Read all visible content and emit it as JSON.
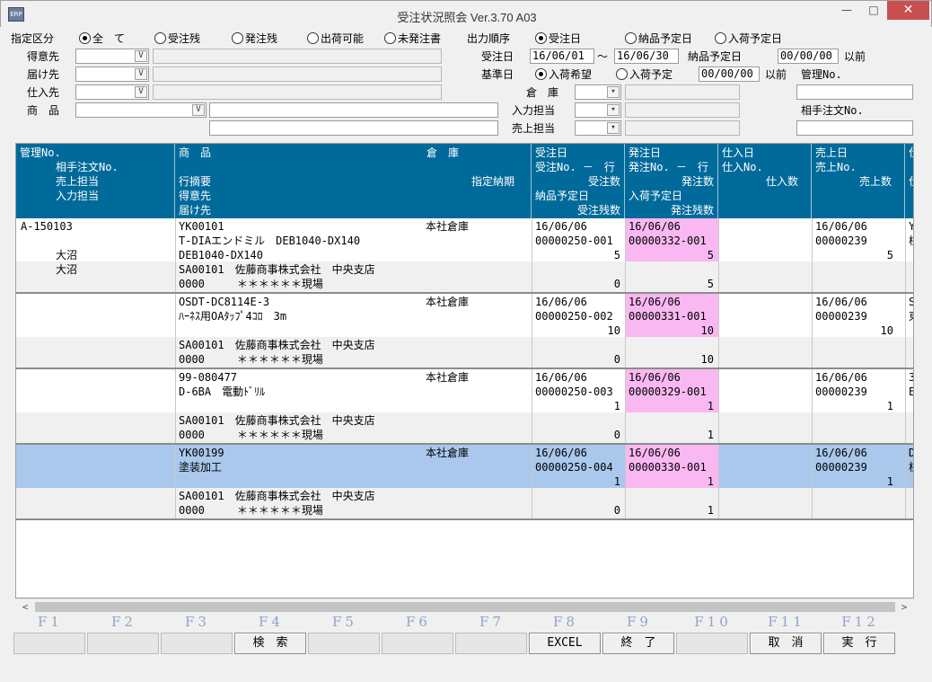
{
  "window": {
    "title": "受注状況照会 Ver.3.70 A03",
    "min_label": "—",
    "max_label": "□",
    "close_label": "✕",
    "icon_text": "ERP"
  },
  "filters": {
    "spec_label": "指定区分",
    "spec_options": [
      {
        "label": "全　て",
        "selected": true
      },
      {
        "label": "受注残",
        "selected": false
      },
      {
        "label": "発注残",
        "selected": false
      },
      {
        "label": "出荷可能",
        "selected": false
      },
      {
        "label": "未発注書",
        "selected": false
      }
    ],
    "order_label": "出力順序",
    "order_options": [
      {
        "label": "受注日",
        "selected": true
      },
      {
        "label": "納品予定日",
        "selected": false
      },
      {
        "label": "入荷予定日",
        "selected": false
      }
    ],
    "customer_label": "得意先",
    "deliver_label": "届け先",
    "supplier_label": "仕入先",
    "product_label": "商　品",
    "order_date_label": "受注日",
    "order_date_from": "16/06/01",
    "tilde": "～",
    "order_date_to": "16/06/30",
    "delivery_plan_label": "納品予定日",
    "delivery_plan_value": "00/00/00",
    "before_label": "以前",
    "base_date_label": "基準日",
    "base_options": [
      {
        "label": "入荷希望",
        "selected": true
      },
      {
        "label": "入荷予定",
        "selected": false
      }
    ],
    "base_date_value": "00/00/00",
    "mgmt_no_label": "管理No.",
    "warehouse_label": "倉　庫",
    "input_person_label": "入力担当",
    "sales_person_label": "売上担当",
    "partner_order_label": "相手注文No.",
    "combo_mark": "V",
    "dropdown_mark": "▾"
  },
  "grid": {
    "headers": {
      "col1": [
        "管理No.",
        "　　手注文No.",
        "　　売上担当",
        "　　入力担当"
      ],
      "col1_line2": "相手注文No.",
      "col2_left": [
        "商　品",
        "",
        "行摘要",
        "得意先",
        "届け先"
      ],
      "col2_warehouse": "倉　庫",
      "col2_delivery": "指定納期",
      "col3": [
        "受注日",
        "受注No. －　行",
        "受注数",
        "納品予定日",
        "受注残数"
      ],
      "col4": [
        "発注日",
        "発注No. －　行",
        "発注数",
        "入荷予定日",
        "発注残数"
      ],
      "col5": [
        "仕入日",
        "仕入No.",
        "仕入数"
      ],
      "col6": [
        "売上日",
        "売上No.",
        "売上数"
      ],
      "col7": [
        "仕",
        "",
        "仕"
      ]
    },
    "rows": [
      {
        "mgmt_no": "A-150103",
        "sales_person": "大沼",
        "input_person": "大沼",
        "product_code": "YK00101",
        "product_name": "T-DIAエンドミル　DEB1040-DX140",
        "line_memo": "DEB1040-DX140",
        "warehouse": "本社倉庫",
        "customer": "SA00101　佐藤商事株式会社　中央支店",
        "deliver": "0000　　　＊＊＊＊＊＊現場",
        "order_date": "16/06/06",
        "order_no": "00000250-001",
        "order_qty": "5",
        "order_remain": "0",
        "po_date": "16/06/06",
        "po_no": "00000332-001",
        "po_qty": "5",
        "po_remain": "5",
        "sale_date": "16/06/06",
        "sale_no": "00000239",
        "sale_qty": "5",
        "col7_a": "Y",
        "col7_b": "棟"
      },
      {
        "mgmt_no": "",
        "sales_person": "",
        "input_person": "",
        "product_code": "OSDT-DC8114E-3",
        "product_name": "ﾊｰﾈｽ用OAﾀｯﾌﾟ4ｺﾛ　3m",
        "line_memo": "",
        "warehouse": "本社倉庫",
        "customer": "SA00101　佐藤商事株式会社　中央支店",
        "deliver": "0000　　　＊＊＊＊＊＊現場",
        "order_date": "16/06/06",
        "order_no": "00000250-002",
        "order_qty": "10",
        "order_remain": "0",
        "po_date": "16/06/06",
        "po_no": "00000331-001",
        "po_qty": "10",
        "po_remain": "10",
        "sale_date": "16/06/06",
        "sale_no": "00000239",
        "sale_qty": "10",
        "col7_a": "S",
        "col7_b": "東"
      },
      {
        "mgmt_no": "",
        "sales_person": "",
        "input_person": "",
        "product_code": "99-080477",
        "product_name": "D-6BA　電動ﾄﾞﾘﾙ",
        "line_memo": "",
        "warehouse": "本社倉庫",
        "customer": "SA00101　佐藤商事株式会社　中央支店",
        "deliver": "0000　　　＊＊＊＊＊＊現場",
        "order_date": "16/06/06",
        "order_no": "00000250-003",
        "order_qty": "1",
        "order_remain": "0",
        "po_date": "16/06/06",
        "po_no": "00000329-001",
        "po_qty": "1",
        "po_remain": "1",
        "sale_date": "16/06/06",
        "sale_no": "00000239",
        "sale_qty": "1",
        "col7_a": "3",
        "col7_b": "E"
      },
      {
        "mgmt_no": "",
        "sales_person": "",
        "input_person": "",
        "product_code": "YK00199",
        "product_name": "塗装加工",
        "line_memo": "",
        "warehouse": "本社倉庫",
        "customer": "SA00101　佐藤商事株式会社　中央支店",
        "deliver": "0000　　　＊＊＊＊＊＊現場",
        "order_date": "16/06/06",
        "order_no": "00000250-004",
        "order_qty": "1",
        "order_remain": "0",
        "po_date": "16/06/06",
        "po_no": "00000330-001",
        "po_qty": "1",
        "po_remain": "1",
        "sale_date": "16/06/06",
        "sale_no": "00000239",
        "sale_qty": "1",
        "col7_a": "D",
        "col7_b": "棟"
      }
    ],
    "scroll_left": "<",
    "scroll_right": ">"
  },
  "fkeys": [
    {
      "key": "F1",
      "label": ""
    },
    {
      "key": "F2",
      "label": ""
    },
    {
      "key": "F3",
      "label": ""
    },
    {
      "key": "F4",
      "label": "検　索"
    },
    {
      "key": "F5",
      "label": ""
    },
    {
      "key": "F6",
      "label": ""
    },
    {
      "key": "F7",
      "label": ""
    },
    {
      "key": "F8",
      "label": "EXCEL"
    },
    {
      "key": "F9",
      "label": "終　了"
    },
    {
      "key": "F10",
      "label": ""
    },
    {
      "key": "F11",
      "label": "取　消"
    },
    {
      "key": "F12",
      "label": "実　行"
    }
  ]
}
